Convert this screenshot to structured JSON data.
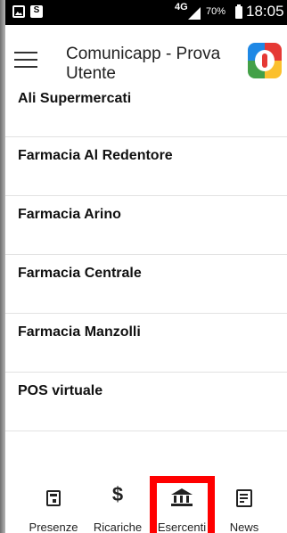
{
  "status_bar": {
    "network": "4G",
    "battery": "70%",
    "time": "18:05"
  },
  "app_bar": {
    "title": "Comunicapp - Prova Utente"
  },
  "merchants": [
    {
      "name": "Ali Supermercati"
    },
    {
      "name": "Farmacia Al Redentore"
    },
    {
      "name": "Farmacia Arino"
    },
    {
      "name": "Farmacia Centrale"
    },
    {
      "name": "Farmacia Manzolli"
    },
    {
      "name": "POS virtuale"
    }
  ],
  "bottom_nav": {
    "presenze": "Presenze",
    "ricariche": "Ricariche",
    "esercenti": "Esercenti",
    "news": "News",
    "active": "Esercenti"
  },
  "colors": {
    "highlight": "#ff0000",
    "status_bar": "#000000"
  }
}
